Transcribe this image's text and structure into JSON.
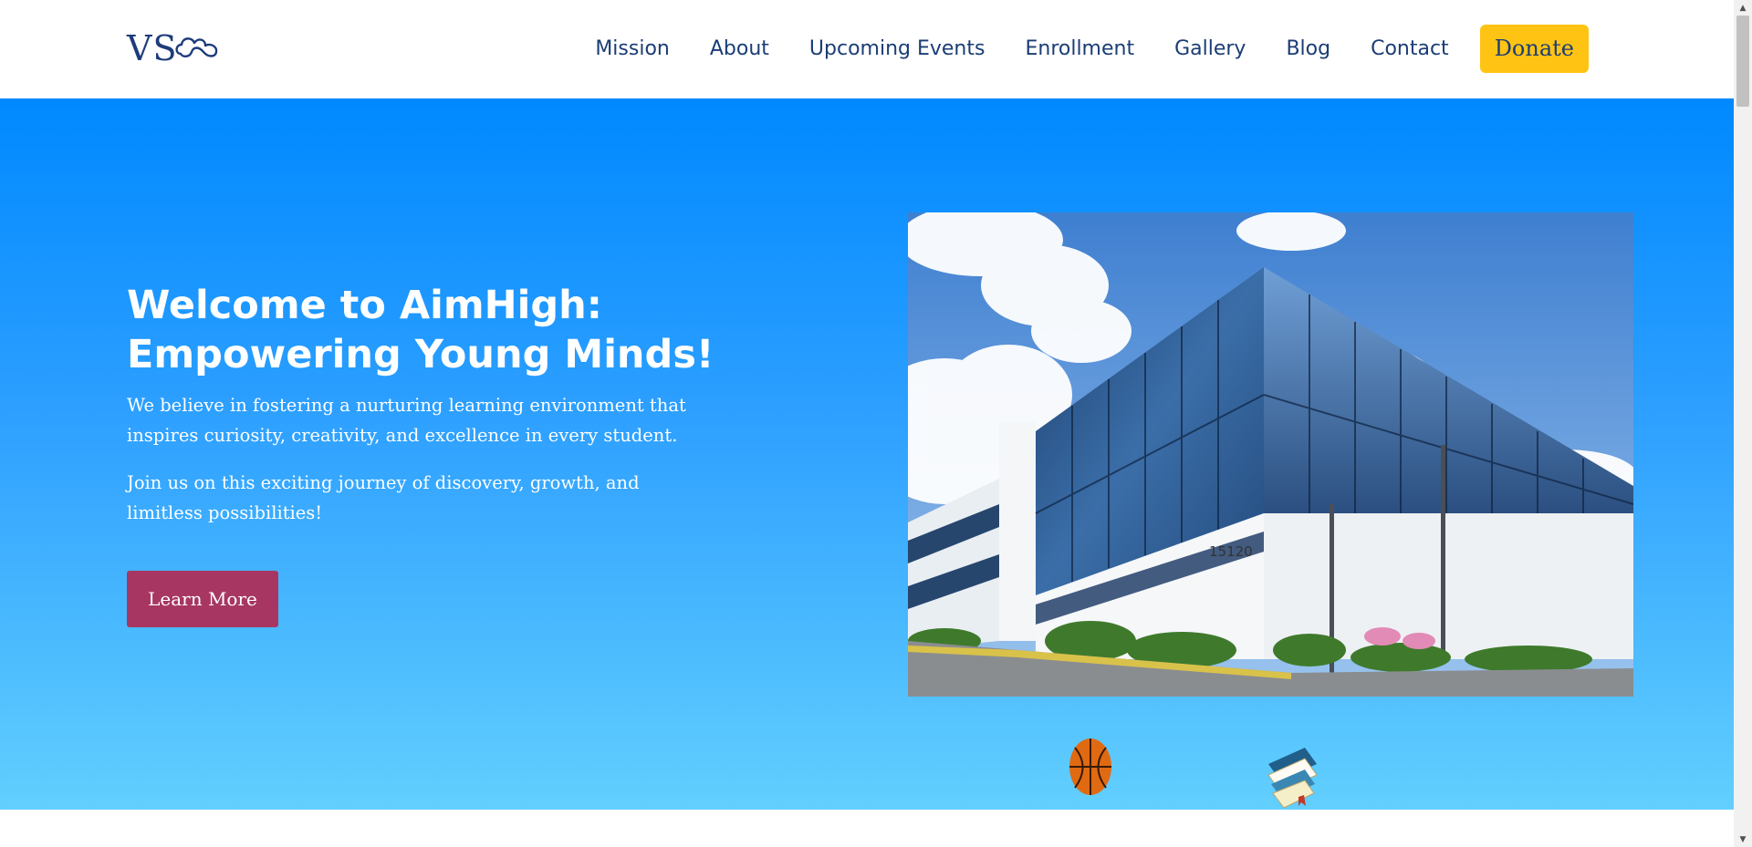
{
  "header": {
    "logo_text": "VS",
    "nav": [
      {
        "label": "Mission"
      },
      {
        "label": "About"
      },
      {
        "label": "Upcoming Events"
      },
      {
        "label": "Enrollment"
      },
      {
        "label": "Gallery"
      },
      {
        "label": "Blog"
      },
      {
        "label": "Contact"
      }
    ],
    "donate_label": "Donate"
  },
  "hero": {
    "title": "Welcome to AimHigh: Empowering Young Minds!",
    "paragraph_1": "We believe in fostering a nurturing learning environment that inspires curiosity, creativity, and excellence in every student.",
    "paragraph_2": "Join us on this exciting journey of discovery, growth, and limitless possibilities!",
    "cta_label": "Learn More",
    "image": {
      "building_number": "15120"
    }
  },
  "icons": {
    "logo_mark": "cloud-infinity-icon",
    "basketball": "basketball-icon",
    "books": "books-icon",
    "scroll_up": "chevron-up-icon",
    "scroll_down": "chevron-down-icon"
  },
  "colors": {
    "brand_navy": "#1b3d75",
    "donate_yellow": "#ffc413",
    "cta_maroon": "#a73762",
    "hero_top": "#0089ff",
    "hero_bottom": "#62cffe"
  }
}
